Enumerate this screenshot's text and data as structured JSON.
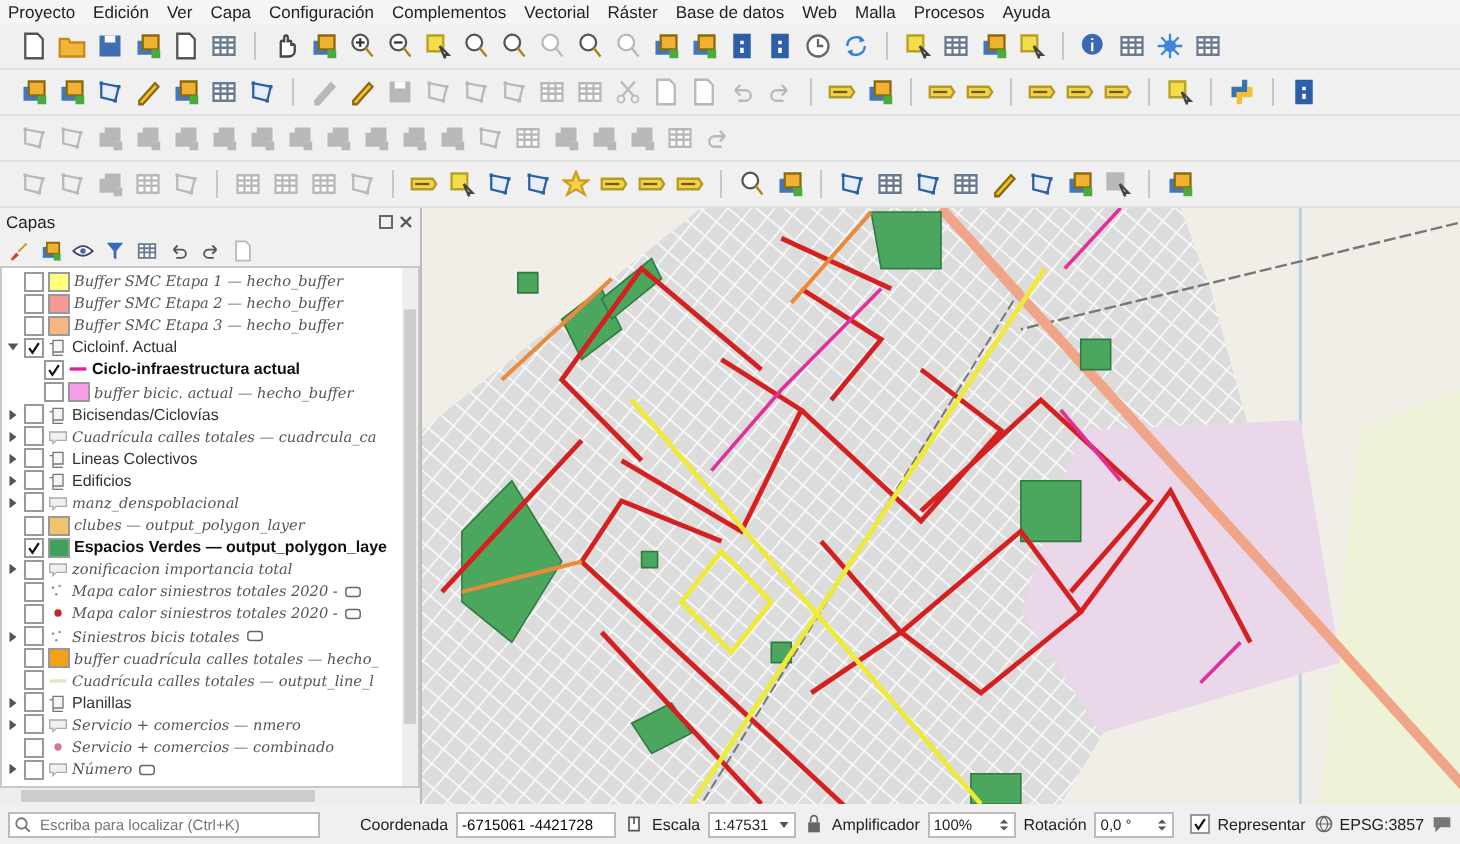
{
  "menu": [
    "Proyecto",
    "Edición",
    "Ver",
    "Capa",
    "Configuración",
    "Complementos",
    "Vectorial",
    "Ráster",
    "Base de datos",
    "Web",
    "Malla",
    "Procesos",
    "Ayuda"
  ],
  "layers_panel": {
    "title": "Capas",
    "layers": [
      {
        "name": "Buffer SMC Etapa 1 — hecho_buffer",
        "checked": false,
        "italic": true,
        "bold": false,
        "symbol": {
          "kind": "fill",
          "color": "#ffff80"
        },
        "indicator": false
      },
      {
        "name": "Buffer SMC Etapa 2 — hecho_buffer",
        "checked": false,
        "italic": true,
        "bold": false,
        "symbol": {
          "kind": "fill",
          "color": "#f49a96"
        },
        "indicator": false
      },
      {
        "name": "Buffer SMC Etapa 3 — hecho_buffer",
        "checked": false,
        "italic": true,
        "bold": false,
        "symbol": {
          "kind": "fill",
          "color": "#f7b784"
        },
        "indicator": false
      },
      {
        "name": "Cicloinf. Actual",
        "checked": true,
        "italic": false,
        "bold": false,
        "expanded": true,
        "symbol": {
          "kind": "group"
        },
        "indicator": false,
        "children": [
          {
            "name": "Ciclo-infraestructura actual",
            "checked": true,
            "italic": false,
            "bold": true,
            "symbol": {
              "kind": "line",
              "color": "#d9259a"
            },
            "indicator": false
          },
          {
            "name": "buffer bicic. actual — hecho_buffer",
            "checked": false,
            "italic": true,
            "bold": false,
            "symbol": {
              "kind": "fill",
              "color": "#f59ee6"
            },
            "indicator": false
          }
        ]
      },
      {
        "name": "Bicisendas/Ciclovías",
        "checked": false,
        "italic": false,
        "bold": false,
        "expanded": false,
        "symbol": {
          "kind": "group"
        },
        "indicator": false
      },
      {
        "name": "Cuadrícula calles totales — cuadrcula_ca",
        "checked": false,
        "italic": true,
        "bold": false,
        "expanded": false,
        "symbol": {
          "kind": "unknown"
        },
        "indicator": false
      },
      {
        "name": "Lineas Colectivos",
        "checked": false,
        "italic": false,
        "bold": false,
        "expanded": false,
        "symbol": {
          "kind": "group"
        },
        "indicator": false
      },
      {
        "name": "Edificios",
        "checked": false,
        "italic": false,
        "bold": false,
        "expanded": false,
        "symbol": {
          "kind": "group"
        },
        "indicator": false
      },
      {
        "name": "manz_denspoblacional",
        "checked": false,
        "italic": true,
        "bold": false,
        "expanded": false,
        "symbol": {
          "kind": "unknown"
        },
        "indicator": false
      },
      {
        "name": "clubes — output_polygon_layer",
        "checked": false,
        "italic": true,
        "bold": false,
        "symbol": {
          "kind": "fill",
          "color": "#efc46a"
        },
        "indicator": false
      },
      {
        "name": "Espacios Verdes — output_polygon_laye",
        "checked": true,
        "italic": false,
        "bold": true,
        "symbol": {
          "kind": "fill",
          "color": "#3ea35a"
        },
        "indicator": false
      },
      {
        "name": "zonificacion importancia total",
        "checked": false,
        "italic": true,
        "bold": false,
        "expanded": false,
        "symbol": {
          "kind": "unknown"
        },
        "indicator": false
      },
      {
        "name": "Mapa calor siniestros totales 2020 -",
        "checked": false,
        "italic": true,
        "bold": false,
        "symbol": {
          "kind": "dots"
        },
        "indicator": true
      },
      {
        "name": "Mapa calor siniestros totales 2020 -",
        "checked": false,
        "italic": true,
        "bold": false,
        "symbol": {
          "kind": "point",
          "color": "#c0282c"
        },
        "indicator": true
      },
      {
        "name": "Siniestros bicis totales",
        "checked": false,
        "italic": true,
        "bold": false,
        "expanded": false,
        "symbol": {
          "kind": "dots"
        },
        "indicator": true
      },
      {
        "name": "buffer cuadrícula calles totales — hecho_",
        "checked": false,
        "italic": true,
        "bold": false,
        "symbol": {
          "kind": "fill",
          "color": "#f5a016"
        },
        "indicator": false
      },
      {
        "name": "Cuadrícula calles totales — output_line_l",
        "checked": false,
        "italic": true,
        "bold": false,
        "symbol": {
          "kind": "line",
          "color": "#e6e4b8"
        },
        "indicator": false
      },
      {
        "name": "Planillas",
        "checked": false,
        "italic": false,
        "bold": false,
        "expanded": false,
        "symbol": {
          "kind": "group"
        },
        "indicator": false
      },
      {
        "name": "Servicio + comercios — nmero",
        "checked": false,
        "italic": true,
        "bold": false,
        "expanded": false,
        "symbol": {
          "kind": "unknown"
        },
        "indicator": false
      },
      {
        "name": "Servicio + comercios — combinado",
        "checked": false,
        "italic": true,
        "bold": false,
        "symbol": {
          "kind": "point",
          "color": "#d4788e"
        },
        "indicator": false
      },
      {
        "name": "Número",
        "checked": false,
        "italic": true,
        "bold": false,
        "expanded": false,
        "symbol": {
          "kind": "unknown"
        },
        "indicator": true
      }
    ]
  },
  "status_bar": {
    "search": {
      "placeholder": "Escriba para localizar (Ctrl+K)"
    },
    "coordinate": {
      "label": "Coordenada",
      "value": "-6715061 -4421728"
    },
    "scale": {
      "label": "Escala",
      "value": "1:47531"
    },
    "magnifier": {
      "label": "Amplificador",
      "value": "100%"
    },
    "rotation": {
      "label": "Rotación",
      "value": "0,0 °"
    },
    "render": {
      "label": "Representar",
      "checked": true
    },
    "crs": "EPSG:3857"
  }
}
